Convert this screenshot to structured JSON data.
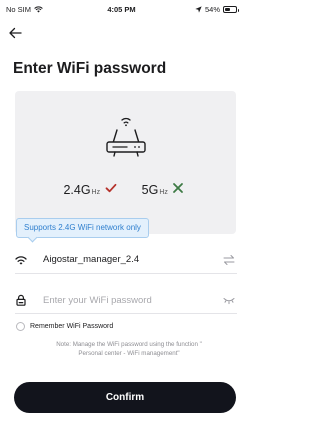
{
  "status_bar": {
    "carrier": "No SIM",
    "time": "4:05 PM",
    "battery_percent": "54%",
    "battery_level": 0.54,
    "icons": [
      "wifi-icon",
      "location-arrow-icon",
      "battery-icon"
    ]
  },
  "header": {
    "back_icon": "arrow-left-icon",
    "title": "Enter WiFi password"
  },
  "illustration": {
    "router_icon": "router-icon",
    "bands": [
      {
        "label": "2.4G",
        "unit": "Hz",
        "supported": true,
        "mark_icon": "check-icon",
        "mark_color": "#b5322c"
      },
      {
        "label": "5G",
        "unit": "Hz",
        "supported": false,
        "mark_icon": "cross-icon",
        "mark_color": "#3d7a45"
      }
    ]
  },
  "tooltip": {
    "text": "Supports 2.4G WiFi network only"
  },
  "wifi": {
    "lead_icon": "wifi-icon",
    "ssid": "Aigostar_manager_2.4",
    "trail_icon": "switch-arrows-icon"
  },
  "password": {
    "lead_icon": "lock-icon",
    "placeholder": "Enter your WiFi password",
    "value": "",
    "trail_icon": "eye-closed-icon"
  },
  "remember": {
    "label": "Remember WiFi Password",
    "checked": false
  },
  "note": {
    "line1": "Note: Manage the WiFi password using the function \"",
    "line2": "Personal center - WiFi management\""
  },
  "confirm": {
    "label": "Confirm"
  },
  "colors": {
    "button_bg": "#12141c",
    "tooltip_text": "#2f7fce",
    "tooltip_bg": "#e3f0fc",
    "illustration_bg": "#f0f0f2"
  }
}
